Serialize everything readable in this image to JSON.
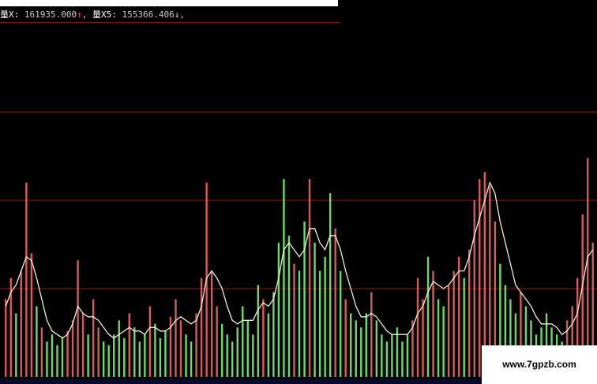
{
  "header": {
    "vol_label": "量X:",
    "vol_value": "161935.000",
    "vol_arrow": "↑",
    "sep": ",",
    "ma5_label": "量X5:",
    "ma5_value": "155366.406",
    "ma5_arrow": "↓",
    "trail": ","
  },
  "watermark": "www.7gpzb.com",
  "colors": {
    "background": "#000000",
    "up": "#ff6a6a",
    "down": "#80ff80",
    "ma_line": "#f0f0d0",
    "grid": "#8b1a1a"
  },
  "chart_data": {
    "type": "bar",
    "description_levels": [
      0.25,
      0.5,
      0.75
    ],
    "bars": [
      {
        "v": 0.22,
        "c": "up"
      },
      {
        "v": 0.28,
        "c": "up"
      },
      {
        "v": 0.18,
        "c": "down"
      },
      {
        "v": 0.3,
        "c": "up"
      },
      {
        "v": 0.55,
        "c": "up"
      },
      {
        "v": 0.35,
        "c": "up"
      },
      {
        "v": 0.2,
        "c": "down"
      },
      {
        "v": 0.14,
        "c": "up"
      },
      {
        "v": 0.1,
        "c": "down"
      },
      {
        "v": 0.12,
        "c": "down"
      },
      {
        "v": 0.09,
        "c": "down"
      },
      {
        "v": 0.11,
        "c": "down"
      },
      {
        "v": 0.13,
        "c": "up"
      },
      {
        "v": 0.16,
        "c": "up"
      },
      {
        "v": 0.33,
        "c": "up"
      },
      {
        "v": 0.18,
        "c": "up"
      },
      {
        "v": 0.12,
        "c": "down"
      },
      {
        "v": 0.22,
        "c": "up"
      },
      {
        "v": 0.14,
        "c": "up"
      },
      {
        "v": 0.1,
        "c": "down"
      },
      {
        "v": 0.09,
        "c": "down"
      },
      {
        "v": 0.12,
        "c": "down"
      },
      {
        "v": 0.16,
        "c": "down"
      },
      {
        "v": 0.11,
        "c": "down"
      },
      {
        "v": 0.18,
        "c": "up"
      },
      {
        "v": 0.14,
        "c": "down"
      },
      {
        "v": 0.1,
        "c": "down"
      },
      {
        "v": 0.12,
        "c": "down"
      },
      {
        "v": 0.2,
        "c": "up"
      },
      {
        "v": 0.15,
        "c": "down"
      },
      {
        "v": 0.11,
        "c": "down"
      },
      {
        "v": 0.13,
        "c": "down"
      },
      {
        "v": 0.17,
        "c": "up"
      },
      {
        "v": 0.22,
        "c": "up"
      },
      {
        "v": 0.16,
        "c": "up"
      },
      {
        "v": 0.12,
        "c": "down"
      },
      {
        "v": 0.1,
        "c": "down"
      },
      {
        "v": 0.18,
        "c": "up"
      },
      {
        "v": 0.28,
        "c": "up"
      },
      {
        "v": 0.55,
        "c": "up"
      },
      {
        "v": 0.3,
        "c": "up"
      },
      {
        "v": 0.2,
        "c": "up"
      },
      {
        "v": 0.15,
        "c": "down"
      },
      {
        "v": 0.12,
        "c": "down"
      },
      {
        "v": 0.1,
        "c": "down"
      },
      {
        "v": 0.14,
        "c": "down"
      },
      {
        "v": 0.2,
        "c": "down"
      },
      {
        "v": 0.16,
        "c": "down"
      },
      {
        "v": 0.12,
        "c": "down"
      },
      {
        "v": 0.26,
        "c": "down"
      },
      {
        "v": 0.22,
        "c": "up"
      },
      {
        "v": 0.18,
        "c": "down"
      },
      {
        "v": 0.24,
        "c": "down"
      },
      {
        "v": 0.38,
        "c": "down"
      },
      {
        "v": 0.56,
        "c": "down"
      },
      {
        "v": 0.4,
        "c": "down"
      },
      {
        "v": 0.32,
        "c": "up"
      },
      {
        "v": 0.3,
        "c": "down"
      },
      {
        "v": 0.44,
        "c": "down"
      },
      {
        "v": 0.56,
        "c": "up"
      },
      {
        "v": 0.38,
        "c": "down"
      },
      {
        "v": 0.3,
        "c": "down"
      },
      {
        "v": 0.34,
        "c": "down"
      },
      {
        "v": 0.52,
        "c": "down"
      },
      {
        "v": 0.42,
        "c": "up"
      },
      {
        "v": 0.3,
        "c": "down"
      },
      {
        "v": 0.22,
        "c": "up"
      },
      {
        "v": 0.18,
        "c": "down"
      },
      {
        "v": 0.16,
        "c": "down"
      },
      {
        "v": 0.14,
        "c": "down"
      },
      {
        "v": 0.18,
        "c": "down"
      },
      {
        "v": 0.24,
        "c": "up"
      },
      {
        "v": 0.16,
        "c": "down"
      },
      {
        "v": 0.12,
        "c": "down"
      },
      {
        "v": 0.1,
        "c": "down"
      },
      {
        "v": 0.12,
        "c": "down"
      },
      {
        "v": 0.14,
        "c": "down"
      },
      {
        "v": 0.1,
        "c": "down"
      },
      {
        "v": 0.12,
        "c": "down"
      },
      {
        "v": 0.16,
        "c": "up"
      },
      {
        "v": 0.28,
        "c": "up"
      },
      {
        "v": 0.22,
        "c": "up"
      },
      {
        "v": 0.34,
        "c": "down"
      },
      {
        "v": 0.3,
        "c": "up"
      },
      {
        "v": 0.22,
        "c": "down"
      },
      {
        "v": 0.2,
        "c": "down"
      },
      {
        "v": 0.26,
        "c": "up"
      },
      {
        "v": 0.3,
        "c": "up"
      },
      {
        "v": 0.34,
        "c": "up"
      },
      {
        "v": 0.28,
        "c": "down"
      },
      {
        "v": 0.36,
        "c": "up"
      },
      {
        "v": 0.5,
        "c": "up"
      },
      {
        "v": 0.56,
        "c": "up"
      },
      {
        "v": 0.58,
        "c": "up"
      },
      {
        "v": 0.54,
        "c": "up"
      },
      {
        "v": 0.44,
        "c": "up"
      },
      {
        "v": 0.32,
        "c": "down"
      },
      {
        "v": 0.26,
        "c": "down"
      },
      {
        "v": 0.22,
        "c": "down"
      },
      {
        "v": 0.18,
        "c": "down"
      },
      {
        "v": 0.24,
        "c": "up"
      },
      {
        "v": 0.2,
        "c": "down"
      },
      {
        "v": 0.16,
        "c": "down"
      },
      {
        "v": 0.12,
        "c": "down"
      },
      {
        "v": 0.14,
        "c": "down"
      },
      {
        "v": 0.18,
        "c": "down"
      },
      {
        "v": 0.14,
        "c": "down"
      },
      {
        "v": 0.12,
        "c": "down"
      },
      {
        "v": 0.1,
        "c": "down"
      },
      {
        "v": 0.16,
        "c": "up"
      },
      {
        "v": 0.2,
        "c": "up"
      },
      {
        "v": 0.28,
        "c": "up"
      },
      {
        "v": 0.46,
        "c": "up"
      },
      {
        "v": 0.62,
        "c": "up"
      },
      {
        "v": 0.38,
        "c": "up"
      }
    ],
    "ma": [
      0.2,
      0.24,
      0.26,
      0.3,
      0.34,
      0.33,
      0.28,
      0.22,
      0.16,
      0.13,
      0.12,
      0.11,
      0.12,
      0.15,
      0.2,
      0.18,
      0.17,
      0.17,
      0.16,
      0.14,
      0.12,
      0.11,
      0.12,
      0.13,
      0.14,
      0.13,
      0.13,
      0.12,
      0.14,
      0.14,
      0.13,
      0.13,
      0.14,
      0.16,
      0.17,
      0.16,
      0.15,
      0.16,
      0.2,
      0.28,
      0.3,
      0.28,
      0.25,
      0.2,
      0.16,
      0.15,
      0.16,
      0.16,
      0.16,
      0.19,
      0.21,
      0.2,
      0.22,
      0.28,
      0.36,
      0.38,
      0.36,
      0.34,
      0.36,
      0.42,
      0.42,
      0.38,
      0.36,
      0.4,
      0.4,
      0.36,
      0.3,
      0.25,
      0.2,
      0.17,
      0.17,
      0.18,
      0.17,
      0.15,
      0.13,
      0.12,
      0.12,
      0.12,
      0.12,
      0.14,
      0.18,
      0.2,
      0.24,
      0.27,
      0.26,
      0.25,
      0.26,
      0.28,
      0.3,
      0.3,
      0.34,
      0.4,
      0.45,
      0.5,
      0.55,
      0.52,
      0.44,
      0.38,
      0.32,
      0.26,
      0.24,
      0.22,
      0.2,
      0.17,
      0.15,
      0.15,
      0.15,
      0.14,
      0.12,
      0.13,
      0.15,
      0.18,
      0.26,
      0.34,
      0.36
    ]
  }
}
